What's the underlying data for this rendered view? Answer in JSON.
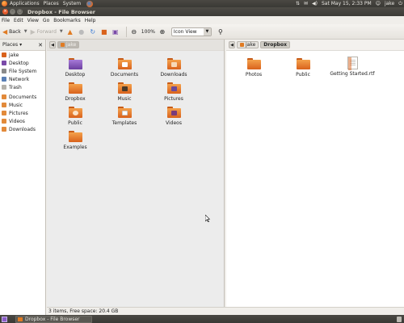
{
  "top_panel": {
    "menus": [
      "Applications",
      "Places",
      "System"
    ],
    "clock": "Sat May 15,  2:33 PM",
    "user": "jake"
  },
  "window": {
    "title": "Dropbox - File Browser"
  },
  "menubar": [
    "File",
    "Edit",
    "View",
    "Go",
    "Bookmarks",
    "Help"
  ],
  "toolbar": {
    "back": "Back",
    "forward": "Forward",
    "zoom": "100%",
    "view_mode": "Icon View"
  },
  "sidebar": {
    "header": "Places",
    "items": [
      "jake",
      "Desktop",
      "File System",
      "Network",
      "Trash",
      "Documents",
      "Music",
      "Pictures",
      "Videos",
      "Downloads"
    ]
  },
  "left_pane": {
    "path": [
      "jake"
    ],
    "items": [
      "Desktop",
      "Documents",
      "Downloads",
      "Dropbox",
      "Music",
      "Pictures",
      "Public",
      "Templates",
      "Videos",
      "Examples"
    ]
  },
  "right_pane": {
    "path": [
      "jake",
      "Dropbox"
    ],
    "items": [
      "Photos",
      "Public",
      "Getting Started.rtf"
    ]
  },
  "statusbar": {
    "text": "3 items, Free space: 20.4 GB"
  },
  "taskbar": {
    "task": "Dropbox - File Browser"
  }
}
